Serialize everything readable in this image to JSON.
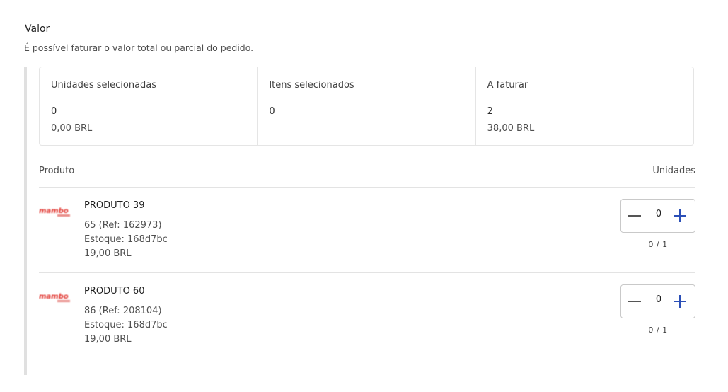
{
  "section": {
    "title": "Valor",
    "subtitle": "É possível faturar o valor total ou parcial do pedido."
  },
  "summary": [
    {
      "label": "Unidades selecionadas",
      "count": "0",
      "amount": "0,00 BRL"
    },
    {
      "label": "Itens selecionados",
      "count": "0",
      "amount": ""
    },
    {
      "label": "A faturar",
      "count": "2",
      "amount": "38,00 BRL"
    }
  ],
  "list": {
    "product_header": "Produto",
    "units_header": "Unidades"
  },
  "products": [
    {
      "name": "PRODUTO 39",
      "sku": "65 (Ref: 162973)",
      "stock": "Estoque: 168d7bc",
      "price": "19,00 BRL",
      "quantity": "0",
      "selected_of_total": "0 / 1",
      "logo_icon": "brand-logo-icon"
    },
    {
      "name": "PRODUTO 60",
      "sku": "86 (Ref: 208104)",
      "stock": "Estoque: 168d7bc",
      "price": "19,00 BRL",
      "quantity": "0",
      "selected_of_total": "0 / 1",
      "logo_icon": "brand-logo-icon"
    }
  ],
  "colors": {
    "accent": "#2b4fb7",
    "logo_red": "#e0302a"
  }
}
